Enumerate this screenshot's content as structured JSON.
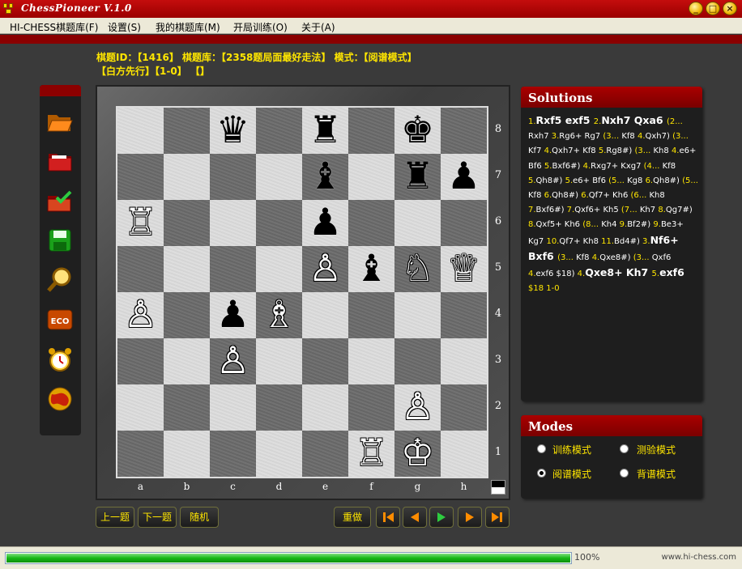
{
  "window": {
    "title": "ChessPioneer V.1.0",
    "min": "_",
    "max": "□",
    "close": "×"
  },
  "menu": [
    "HI-CHESS棋题库(F)",
    "设置(S)",
    "我的棋题库(M)",
    "开局训练(O)",
    "关于(A)"
  ],
  "info": {
    "line1": "棋题ID：【1416】 棋题库：【2358题局面最好走法】 模式：【阅谱模式】",
    "line2": "【白方先行】【1-0】 【】"
  },
  "toolbar_icons": [
    "open-folder-icon",
    "red-folder-icon",
    "checked-folder-icon",
    "save-disk-icon",
    "magnifier-icon",
    "eco-icon",
    "alarm-clock-icon",
    "globe-icon"
  ],
  "toolbar_eco": "ECO",
  "board": {
    "files": [
      "a",
      "b",
      "c",
      "d",
      "e",
      "f",
      "g",
      "h"
    ],
    "ranks": [
      "8",
      "7",
      "6",
      "5",
      "4",
      "3",
      "2",
      "1"
    ],
    "pieces": [
      {
        "sq": "c8",
        "glyph": "♛",
        "color": "black",
        "name": "black-queen-icon"
      },
      {
        "sq": "e8",
        "glyph": "♜",
        "color": "black",
        "name": "black-rook-icon"
      },
      {
        "sq": "g8",
        "glyph": "♚",
        "color": "black",
        "name": "black-king-icon"
      },
      {
        "sq": "e7",
        "glyph": "♝",
        "color": "black",
        "name": "black-bishop-icon"
      },
      {
        "sq": "g7",
        "glyph": "♜",
        "color": "black",
        "name": "black-rook-icon"
      },
      {
        "sq": "h7",
        "glyph": "♟",
        "color": "black",
        "name": "black-pawn-icon"
      },
      {
        "sq": "a6",
        "glyph": "♖",
        "color": "white",
        "name": "white-rook-icon"
      },
      {
        "sq": "e6",
        "glyph": "♟",
        "color": "black",
        "name": "black-pawn-icon"
      },
      {
        "sq": "e5",
        "glyph": "♙",
        "color": "white",
        "name": "white-pawn-icon"
      },
      {
        "sq": "f5",
        "glyph": "♝",
        "color": "black",
        "name": "black-bishop-icon"
      },
      {
        "sq": "g5",
        "glyph": "♘",
        "color": "white",
        "name": "white-knight-icon"
      },
      {
        "sq": "h5",
        "glyph": "♕",
        "color": "white",
        "name": "white-queen-icon"
      },
      {
        "sq": "a4",
        "glyph": "♙",
        "color": "white",
        "name": "white-pawn-icon"
      },
      {
        "sq": "c4",
        "glyph": "♟",
        "color": "black",
        "name": "black-pawn-icon"
      },
      {
        "sq": "d4",
        "glyph": "♗",
        "color": "white",
        "name": "white-bishop-icon"
      },
      {
        "sq": "c3",
        "glyph": "♙",
        "color": "white",
        "name": "white-pawn-icon"
      },
      {
        "sq": "g2",
        "glyph": "♙",
        "color": "white",
        "name": "white-pawn-icon"
      },
      {
        "sq": "f1",
        "glyph": "♖",
        "color": "white",
        "name": "white-rook-icon"
      },
      {
        "sq": "g1",
        "glyph": "♔",
        "color": "white",
        "name": "white-king-icon"
      }
    ]
  },
  "nav_buttons": {
    "prev": "上一题",
    "next": "下一题",
    "random": "随机",
    "redo": "重做"
  },
  "playback_icons": [
    "first-move-icon",
    "prev-move-icon",
    "play-icon",
    "next-move-icon",
    "last-move-icon"
  ],
  "solutions": {
    "title": "Solutions",
    "tokens": [
      {
        "t": "1.",
        "c": "n"
      },
      {
        "t": "Rxf5 exf5 ",
        "c": "m"
      },
      {
        "t": "2.",
        "c": "n"
      },
      {
        "t": "Nxh7 Qxa6 ",
        "c": "m"
      },
      {
        "t": "(2... ",
        "c": "n"
      },
      {
        "t": "Rxh7 ",
        "c": "w"
      },
      {
        "t": "3.",
        "c": "n"
      },
      {
        "t": "Rg6+ Rg7 ",
        "c": "w"
      },
      {
        "t": "(3... ",
        "c": "n"
      },
      {
        "t": "Kf8 ",
        "c": "w"
      },
      {
        "t": "4.",
        "c": "n"
      },
      {
        "t": "Qxh7) ",
        "c": "w"
      },
      {
        "t": "(3... ",
        "c": "n"
      },
      {
        "t": "Kf7 ",
        "c": "w"
      },
      {
        "t": "4.",
        "c": "n"
      },
      {
        "t": "Qxh7+ Kf8 ",
        "c": "w"
      },
      {
        "t": "5.",
        "c": "n"
      },
      {
        "t": "Rg8#) ",
        "c": "w"
      },
      {
        "t": "(3... ",
        "c": "n"
      },
      {
        "t": "Kh8 ",
        "c": "w"
      },
      {
        "t": "4.",
        "c": "n"
      },
      {
        "t": "e6+ Bf6 ",
        "c": "w"
      },
      {
        "t": "5.",
        "c": "n"
      },
      {
        "t": "Bxf6#) ",
        "c": "w"
      },
      {
        "t": "4.",
        "c": "n"
      },
      {
        "t": "Rxg7+ Kxg7 ",
        "c": "w"
      },
      {
        "t": "(4... ",
        "c": "n"
      },
      {
        "t": "Kf8 ",
        "c": "w"
      },
      {
        "t": "5.",
        "c": "n"
      },
      {
        "t": "Qh8#) ",
        "c": "w"
      },
      {
        "t": "5.",
        "c": "n"
      },
      {
        "t": "e6+ Bf6 ",
        "c": "w"
      },
      {
        "t": "(5... ",
        "c": "n"
      },
      {
        "t": "Kg8 ",
        "c": "w"
      },
      {
        "t": "6.",
        "c": "n"
      },
      {
        "t": "Qh8#) ",
        "c": "w"
      },
      {
        "t": "(5... ",
        "c": "n"
      },
      {
        "t": "Kf8 ",
        "c": "w"
      },
      {
        "t": "6.",
        "c": "n"
      },
      {
        "t": "Qh8#) ",
        "c": "w"
      },
      {
        "t": "6.",
        "c": "n"
      },
      {
        "t": "Qf7+ Kh6 ",
        "c": "w"
      },
      {
        "t": "(6... ",
        "c": "n"
      },
      {
        "t": "Kh8 ",
        "c": "w"
      },
      {
        "t": "7.",
        "c": "n"
      },
      {
        "t": "Bxf6#) ",
        "c": "w"
      },
      {
        "t": "7.",
        "c": "n"
      },
      {
        "t": "Qxf6+ Kh5 ",
        "c": "w"
      },
      {
        "t": "(7... ",
        "c": "n"
      },
      {
        "t": "Kh7 ",
        "c": "w"
      },
      {
        "t": "8.",
        "c": "n"
      },
      {
        "t": "Qg7#) ",
        "c": "w"
      },
      {
        "t": "8.",
        "c": "n"
      },
      {
        "t": "Qxf5+ Kh6 ",
        "c": "w"
      },
      {
        "t": "(8... ",
        "c": "n"
      },
      {
        "t": "Kh4 ",
        "c": "w"
      },
      {
        "t": "9.",
        "c": "n"
      },
      {
        "t": "Bf2#) ",
        "c": "w"
      },
      {
        "t": "9.",
        "c": "n"
      },
      {
        "t": "Be3+ Kg7 ",
        "c": "w"
      },
      {
        "t": "10.",
        "c": "n"
      },
      {
        "t": "Qf7+ Kh8 ",
        "c": "w"
      },
      {
        "t": "11.",
        "c": "n"
      },
      {
        "t": "Bd4#) ",
        "c": "w"
      },
      {
        "t": "3.",
        "c": "n"
      },
      {
        "t": "Nf6+ Bxf6 ",
        "c": "m"
      },
      {
        "t": "(3... ",
        "c": "n"
      },
      {
        "t": "Kf8 ",
        "c": "w"
      },
      {
        "t": "4.",
        "c": "n"
      },
      {
        "t": "Qxe8#) ",
        "c": "w"
      },
      {
        "t": "(3... ",
        "c": "n"
      },
      {
        "t": "Qxf6 ",
        "c": "w"
      },
      {
        "t": "4.",
        "c": "n"
      },
      {
        "t": "exf6 $18) ",
        "c": "w"
      },
      {
        "t": "4.",
        "c": "n"
      },
      {
        "t": "Qxe8+ Kh7 ",
        "c": "m"
      },
      {
        "t": "5.",
        "c": "n"
      },
      {
        "t": "exf6 ",
        "c": "m"
      },
      {
        "t": "$18 1-0",
        "c": "n"
      }
    ]
  },
  "modes": {
    "title": "Modes",
    "options": [
      {
        "label": "训练模式",
        "checked": false
      },
      {
        "label": "测验模式",
        "checked": false
      },
      {
        "label": "阅谱模式",
        "checked": true
      },
      {
        "label": "背谱模式",
        "checked": false
      }
    ]
  },
  "status": {
    "progress": 100,
    "progress_text": "100%",
    "site": "www.hi-chess.com"
  }
}
